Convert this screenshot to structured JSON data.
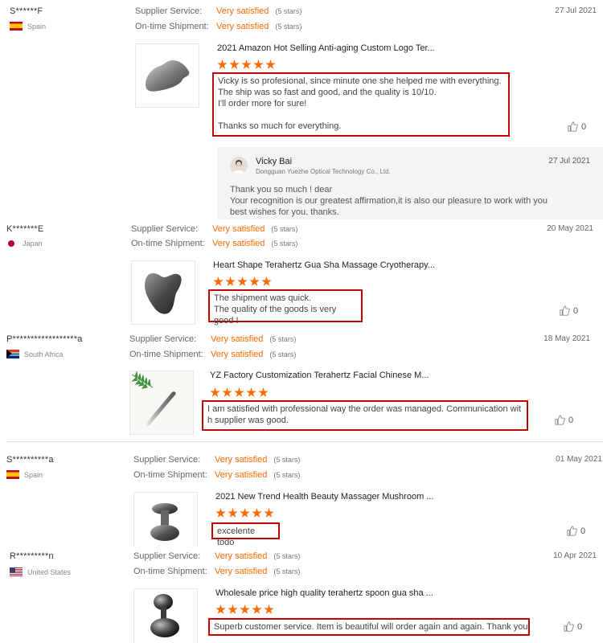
{
  "colors": {
    "accent": "#ff6a00",
    "highlight_border": "#c40000"
  },
  "labels": {
    "supplier_service": "Supplier Service:",
    "on_time_shipment": "On-time Shipment:"
  },
  "reviews": [
    {
      "user": "S******F",
      "country": "Spain",
      "flag": "flag-es",
      "supplier_service": "Very satisfied",
      "supplier_service_stars": "(5 stars)",
      "on_time_shipment": "Very satisfied",
      "on_time_shipment_stars": "(5 stars)",
      "date": "27 Jul 2021",
      "product_title": "2021 Amazon Hot Selling Anti-aging Custom Logo Ter...",
      "product_rating": 5,
      "comment": "Vicky is so profesional, since minute one she helped me with everything.\nThe ship was so fast and good, and the quality is 10/10.\nI'll order more for sure!\n\nThanks so much for everything.",
      "likes": "0",
      "reply": {
        "name": "Vicky Bai",
        "company": "Dongguan Yuezhe Optical Technology Co., Ltd.",
        "date": "27 Jul 2021",
        "text": "Thank you so much ! dear\nYour recognition is our greatest affirmation,it is also our pleasure to work with you\nbest wishes for you. thanks."
      }
    },
    {
      "user": "K*******E",
      "country": "Japan",
      "flag": "flag-jp",
      "supplier_service": "Very satisfied",
      "supplier_service_stars": "(5 stars)",
      "on_time_shipment": "Very satisfied",
      "on_time_shipment_stars": "(5 stars)",
      "date": "20 May 2021",
      "product_title": "Heart Shape Terahertz Gua Sha Massage Cryotherapy...",
      "product_rating": 5,
      "comment": "The shipment was quick.\nThe quality of the goods is very good !",
      "likes": "0"
    },
    {
      "user": "P******************a",
      "country": "South Africa",
      "flag": "flag-za",
      "supplier_service": "Very satisfied",
      "supplier_service_stars": "(5 stars)",
      "on_time_shipment": "Very satisfied",
      "on_time_shipment_stars": "(5 stars)",
      "date": "18 May 2021",
      "product_title": "YZ Factory Customization Terahertz Facial Chinese M...",
      "product_rating": 5,
      "comment": "I am satisfied with professional way the order was managed. Communication wit\nh supplier was good.",
      "likes": "0"
    },
    {
      "user": "S**********a",
      "country": "Spain",
      "flag": "flag-es",
      "supplier_service": "Very satisfied",
      "supplier_service_stars": "(5 stars)",
      "on_time_shipment": "Very satisfied",
      "on_time_shipment_stars": "(5 stars)",
      "date": "01 May 2021",
      "product_title": "2021 New Trend Health Beauty Massager Mushroom ...",
      "product_rating": 5,
      "comment": "excelente todo",
      "likes": "0"
    },
    {
      "user": "R*********n",
      "country": "United States",
      "flag": "flag-us",
      "supplier_service": "Very satisfied",
      "supplier_service_stars": "(5 stars)",
      "on_time_shipment": "Very satisfied",
      "on_time_shipment_stars": "(5 stars)",
      "date": "10 Apr 2021",
      "product_title": "Wholesale price high quality terahertz spoon gua sha ...",
      "product_rating": 5,
      "comment": "Superb customer service. Item is beautiful will order again and again. Thank you!",
      "likes": "0"
    }
  ]
}
